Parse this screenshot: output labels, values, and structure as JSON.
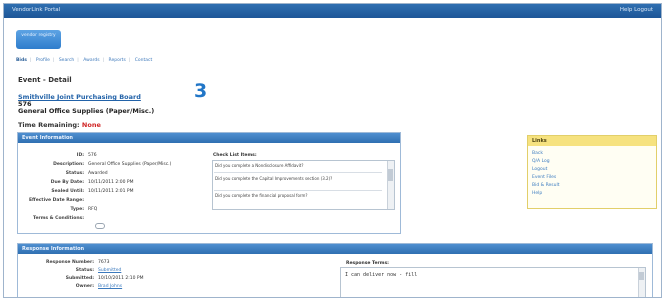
{
  "app": {
    "title": "VendorLink Portal",
    "header_right": "Help  Logout"
  },
  "nav": {
    "vendor_button": "vendor registry",
    "links": [
      "Bids",
      "Profile",
      "Search",
      "Awards",
      "Reports",
      "Contact"
    ]
  },
  "event": {
    "heading": "Event - Detail",
    "agency": "Smithville Joint Purchasing Board",
    "number": "576",
    "name": "General Office Supplies (Paper/Misc.)",
    "time_label": "Time Remaining:",
    "time_value": "None"
  },
  "step_marker": "3",
  "event_info": {
    "title": "Event Information",
    "fields": [
      {
        "label": "ID:",
        "value": "576"
      },
      {
        "label": "Description:",
        "value": "General Office Supplies (Paper/Misc.)"
      },
      {
        "label": "Status:",
        "value": "Awarded"
      },
      {
        "label": "Due By Date:",
        "value": "10/11/2011 2:00 PM"
      },
      {
        "label": "Sealed Until:",
        "value": "10/11/2011 2:01 PM"
      },
      {
        "label": "Effective Date Range:",
        "value": ""
      },
      {
        "label": "Type:",
        "value": "RFQ"
      },
      {
        "label": "Terms & Conditions:",
        "value": ""
      }
    ],
    "checklist_title": "Check List Items:",
    "checklist": [
      "Did you complete a Nondisclosure Affidavit?",
      "Did you complete the Capital Improvements section (3.2)?",
      "Did you complete the financial proposal form?"
    ]
  },
  "links_panel": {
    "title": "Links",
    "items": [
      "Back",
      "Q/A Log",
      "Logout",
      "Event Files",
      "Bid & Result",
      "Help"
    ]
  },
  "response_info": {
    "title": "Response Information",
    "fields": [
      {
        "label": "Response Number:",
        "value": "7673",
        "link": false
      },
      {
        "label": "Status:",
        "value": "Submitted",
        "link": true
      },
      {
        "label": "Submitted:",
        "value": "10/10/2011 2:10 PM",
        "link": false
      },
      {
        "label": "Owner:",
        "value": "Brad Johns",
        "link": true
      }
    ],
    "terms_title": "Response Terms:",
    "terms_text": "I can deliver now - fill"
  }
}
